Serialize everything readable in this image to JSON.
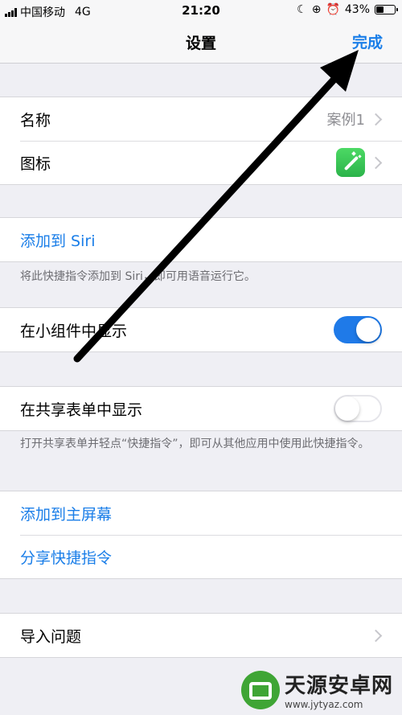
{
  "status_bar": {
    "carrier": "中国移动",
    "network": "4G",
    "time": "21:20",
    "battery_percent": "43%",
    "battery_level": 0.43
  },
  "nav": {
    "title": "设置",
    "done_label": "完成"
  },
  "group1": {
    "name_label": "名称",
    "name_value": "案例1",
    "icon_label": "图标",
    "icon_color": "#4cd964"
  },
  "siri": {
    "add_label": "添加到 Siri",
    "note": "将此快捷指令添加到 Siri，即可用语音运行它。"
  },
  "widget": {
    "label": "在小组件中显示",
    "enabled": true
  },
  "share_sheet": {
    "label": "在共享表单中显示",
    "enabled": false,
    "note": "打开共享表单并轻点“快捷指令”，即可从其他应用中使用此快捷指令。"
  },
  "actions": {
    "add_home_label": "添加到主屏幕",
    "share_label": "分享快捷指令"
  },
  "import": {
    "label": "导入问题"
  },
  "watermark": {
    "name": "天源安卓网",
    "url": "www.jytyaz.com"
  },
  "colors": {
    "accent": "#1a7ee8",
    "toggle_on": "#1f7ae8",
    "background": "#efeff4"
  }
}
